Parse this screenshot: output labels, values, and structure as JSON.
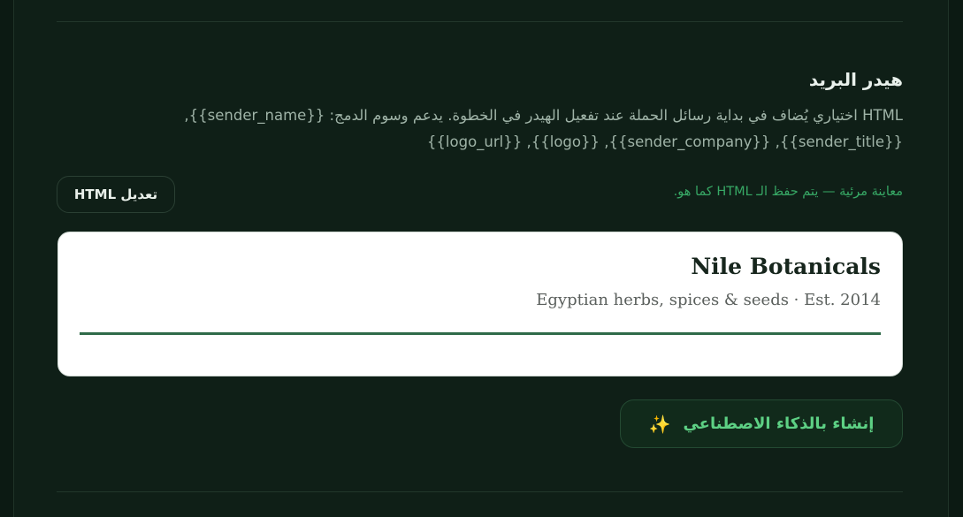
{
  "section": {
    "title": "هيدر البريد",
    "description": "HTML اختياري يُضاف في بداية رسائل الحملة عند تفعيل الهيدر في الخطوة. يدعم وسوم الدمج: {{sender_name}}, {{sender_title}}, {{sender_company}}, {{logo}}, {{logo_url}}",
    "preview_note": "معاينة مرئية — يتم حفظ الـ HTML كما هو.",
    "edit_button_label": "تعديل HTML"
  },
  "preview": {
    "brand_name": "Nile Botanicals",
    "tagline": "Egyptian herbs, spices & seeds · Est. 2014"
  },
  "ai_button": {
    "label": "إنشاء بالذكاء الاصطناعي",
    "icon": "sparkles-icon",
    "icon_glyph": "✨"
  },
  "colors": {
    "background": "#0f1f17",
    "accent_green": "#5dd084",
    "note_green": "#37a865",
    "preview_rule": "#2f6a48"
  }
}
